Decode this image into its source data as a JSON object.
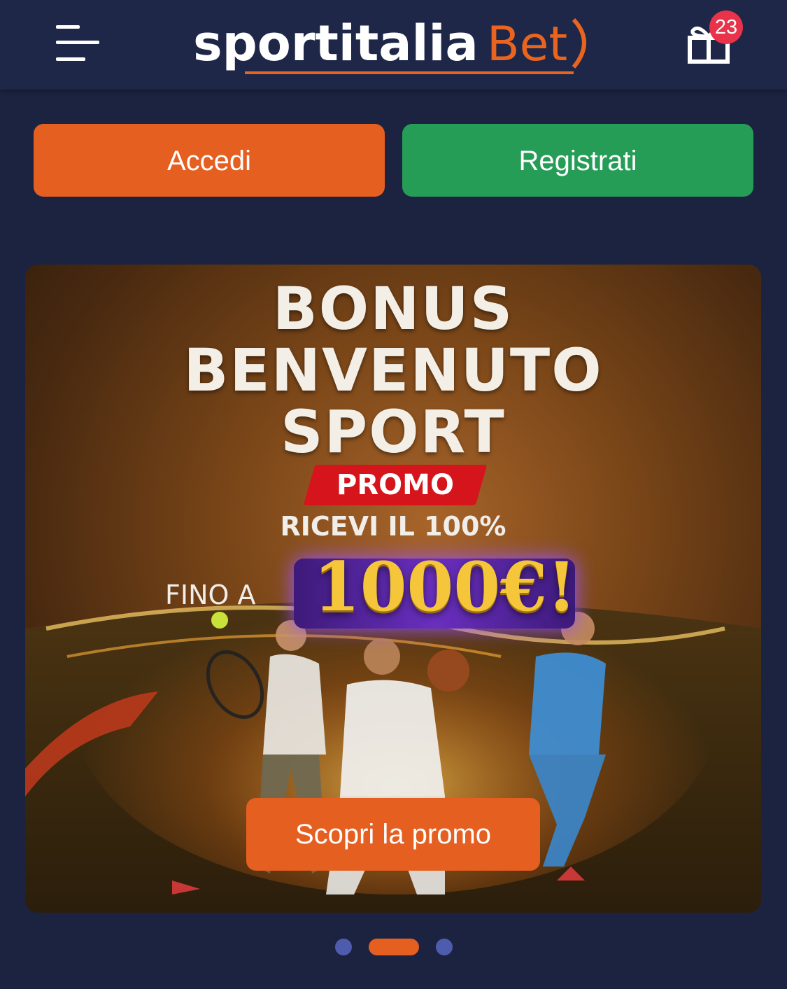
{
  "header": {
    "logo_main": "sportitalia",
    "logo_accent": "Bet",
    "gift_count": "23"
  },
  "auth": {
    "login_label": "Accedi",
    "register_label": "Registrati"
  },
  "banner": {
    "title_line1": "BONUS",
    "title_line2": "BENVENUTO",
    "title_line3": "SPORT",
    "promo_tag": "PROMO",
    "subtitle": "RICEVI IL 100%",
    "prefix": "FINO A",
    "amount": "1000€!",
    "cta_label": "Scopri la promo"
  },
  "carousel": {
    "slides": 3,
    "active_index": 1
  },
  "colors": {
    "header_bg": "#1e2747",
    "page_bg": "#1b2340",
    "accent_orange": "#e55f21",
    "accent_green": "#269d57",
    "badge_red": "#e8334a",
    "dot_inactive": "#4f5cae"
  },
  "icons": {
    "menu": "hamburger-menu-icon",
    "gift": "gift-icon"
  }
}
